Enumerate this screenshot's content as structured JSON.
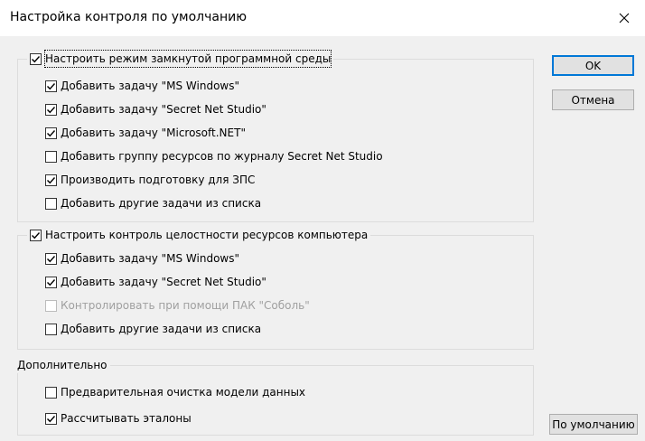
{
  "window": {
    "title": "Настройка контроля по умолчанию",
    "close_glyph": "close-icon"
  },
  "group_env": {
    "header": {
      "label": "Настроить режим замкнутой программной среды",
      "checked": true
    },
    "items": [
      {
        "label": "Добавить задачу \"MS Windows\"",
        "checked": true,
        "enabled": true
      },
      {
        "label": "Добавить задачу \"Secret Net Studio\"",
        "checked": true,
        "enabled": true
      },
      {
        "label": "Добавить задачу \"Microsoft.NET\"",
        "checked": true,
        "enabled": true
      },
      {
        "label": "Добавить группу ресурсов по журналу Secret Net Studio",
        "checked": false,
        "enabled": true
      },
      {
        "label": "Производить подготовку для ЗПС",
        "checked": true,
        "enabled": true
      },
      {
        "label": "Добавить другие задачи из списка",
        "checked": false,
        "enabled": true
      }
    ]
  },
  "group_integrity": {
    "header": {
      "label": "Настроить контроль целостности ресурсов компьютера",
      "checked": true
    },
    "items": [
      {
        "label": "Добавить задачу \"MS Windows\"",
        "checked": true,
        "enabled": true
      },
      {
        "label": "Добавить задачу \"Secret Net Studio\"",
        "checked": true,
        "enabled": true
      },
      {
        "label": "Контролировать при помощи ПАК \"Соболь\"",
        "checked": false,
        "enabled": false
      },
      {
        "label": "Добавить другие задачи из списка",
        "checked": false,
        "enabled": true
      }
    ]
  },
  "group_extra": {
    "header": {
      "label": "Дополнительно"
    },
    "items": [
      {
        "label": "Предварительная очистка модели данных",
        "checked": false,
        "enabled": true
      },
      {
        "label": "Рассчитывать эталоны",
        "checked": true,
        "enabled": true
      }
    ]
  },
  "buttons": {
    "ok": "OK",
    "cancel": "Отмена",
    "defaults": "По умолчанию"
  },
  "colors": {
    "default_button_border": "#0078d7",
    "disabled_text": "#a0a0a0"
  }
}
